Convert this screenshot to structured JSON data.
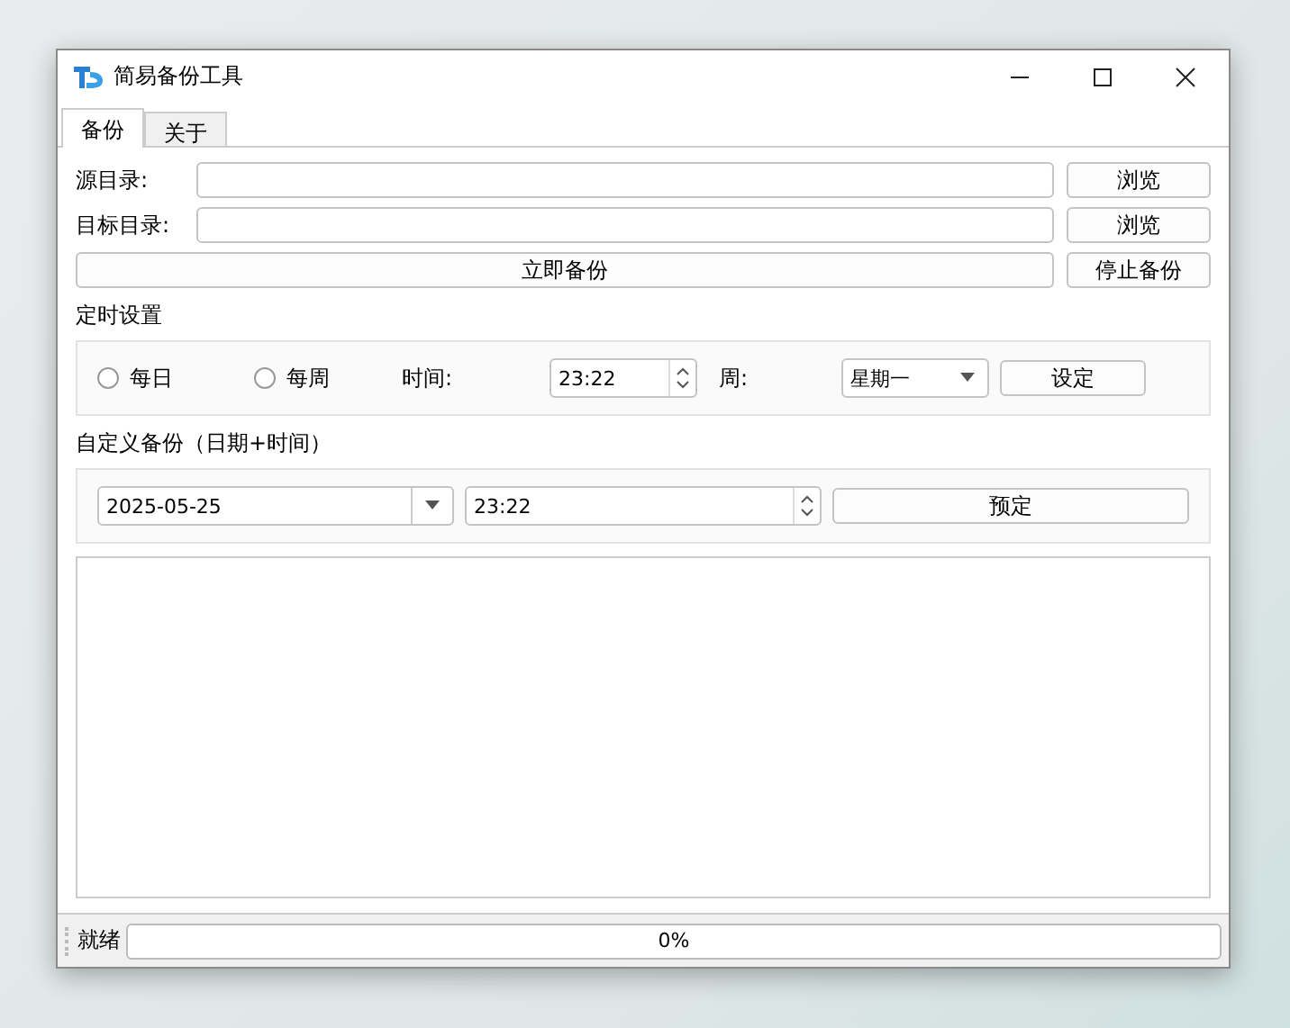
{
  "window": {
    "title": "简易备份工具"
  },
  "tabs": [
    {
      "label": "备份",
      "selected": true
    },
    {
      "label": "关于",
      "selected": false
    }
  ],
  "dir_rows": [
    {
      "label": "源目录:",
      "button": "浏览"
    },
    {
      "label": "目标目录:",
      "button": "浏览"
    }
  ],
  "backup_now_button": "立即备份",
  "stop_button": "停止备份",
  "schedule": {
    "title": "定时设置",
    "radios": [
      {
        "label": "每日",
        "selected": false
      },
      {
        "label": "每周",
        "selected": false
      }
    ],
    "time_label": "时间:",
    "time_value": "23:22",
    "week_label": "周:",
    "week_value": "星期一",
    "set_button": "设定"
  },
  "custom": {
    "title": "自定义备份（日期+时间）",
    "date_value": "2025-05-25",
    "time_value": "23:22",
    "button": "预定"
  },
  "status_bar": {
    "text": "就绪",
    "progress": {
      "level": 0,
      "label": "0%"
    }
  }
}
